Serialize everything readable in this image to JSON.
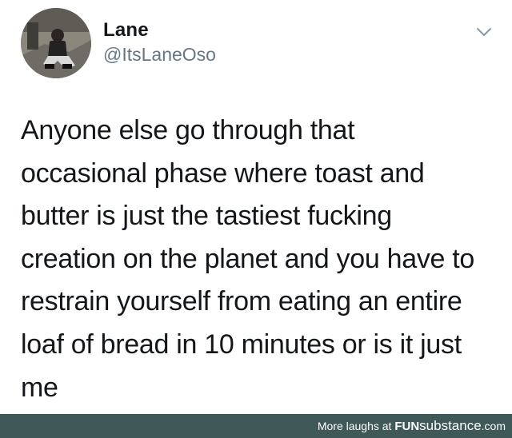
{
  "tweet": {
    "author_name": "Lane",
    "author_handle": "@ItsLaneOso",
    "text_lines": [
      "Anyone else go through that",
      "occasional phase where toast and",
      "butter is just the tastiest fucking",
      "creation on the planet and you have to",
      "restrain yourself from eating an entire",
      "loaf of bread in 10 minutes or is it  just",
      "me"
    ],
    "menu_icon": "chevron-down-icon",
    "avatar_icon": "avatar"
  },
  "footer": {
    "prefix": "More laughs at ",
    "brand_bold": "FUN",
    "brand_rest": "substance",
    "brand_suffix": ".com",
    "background_color": "#3e5957"
  }
}
